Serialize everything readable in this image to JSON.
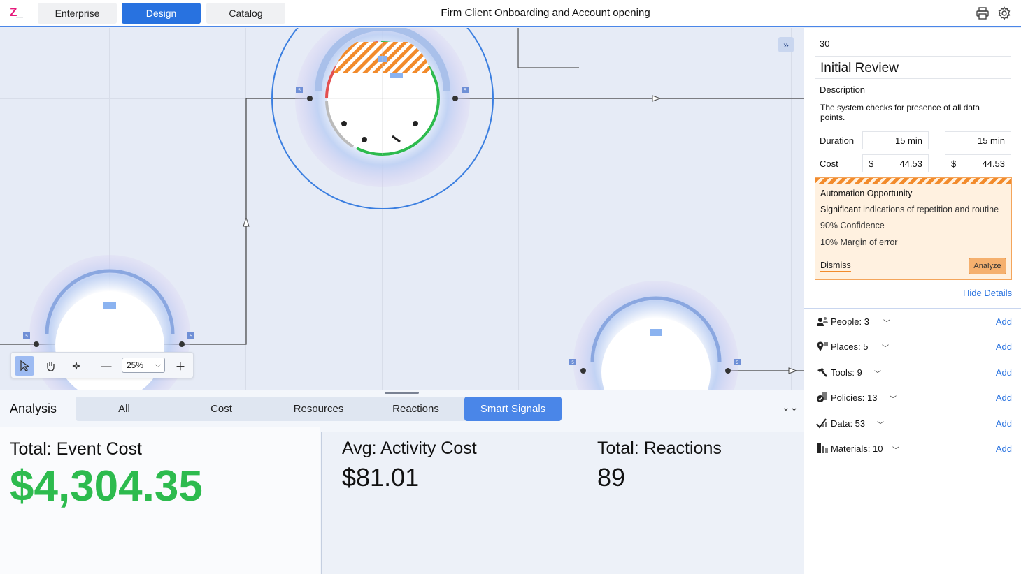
{
  "topbar": {
    "logo": "Z",
    "logo_mark": "_",
    "tabs": [
      {
        "label": "Enterprise",
        "active": false
      },
      {
        "label": "Design",
        "active": true
      },
      {
        "label": "Catalog",
        "active": false
      }
    ],
    "title": "Firm Client Onboarding and Account opening",
    "icons": [
      "print-icon",
      "gear-icon"
    ]
  },
  "canvas": {
    "node_badge": "5",
    "zoom": "25%"
  },
  "analysis": {
    "title": "Analysis",
    "tabs": [
      {
        "label": "All",
        "active": false
      },
      {
        "label": "Cost",
        "active": false
      },
      {
        "label": "Resources",
        "active": false
      },
      {
        "label": "Reactions",
        "active": false
      },
      {
        "label": "Smart Signals",
        "active": true
      }
    ],
    "metrics": [
      {
        "label": "Total: Event Cost",
        "value": "$4,304.35"
      },
      {
        "label": "Avg: Activity Cost",
        "value": "$81.01"
      },
      {
        "label": "Total: Reactions",
        "value": "89"
      }
    ],
    "accent_color": "#2dbb4e"
  },
  "details": {
    "number": "30",
    "name": "Initial Review",
    "description_label": "Description",
    "description": "The system checks for presence of all data points.",
    "duration_label": "Duration",
    "duration_values": [
      "15 min",
      "15 min"
    ],
    "cost_label": "Cost",
    "currency": "$",
    "cost_values": [
      "44.53",
      "44.53"
    ],
    "automation": {
      "title": "Automation Opportunity",
      "line_bold": "Significant",
      "line_rest": " indications of repetition and routine",
      "confidence": "90% Confidence",
      "margin": "10% Margin of error",
      "dismiss": "Dismiss",
      "analyze": "Analyze"
    },
    "hide_details": "Hide Details",
    "resources": [
      {
        "label": "People: 3",
        "icon": "people-icon",
        "add": "Add"
      },
      {
        "label": "Places: 5",
        "icon": "places-icon",
        "add": "Add"
      },
      {
        "label": "Tools: 9",
        "icon": "tools-icon",
        "add": "Add"
      },
      {
        "label": "Policies: 13",
        "icon": "policies-icon",
        "add": "Add"
      },
      {
        "label": "Data: 53",
        "icon": "data-icon",
        "add": "Add"
      },
      {
        "label": "Materials: 10",
        "icon": "materials-icon",
        "add": "Add"
      }
    ]
  }
}
